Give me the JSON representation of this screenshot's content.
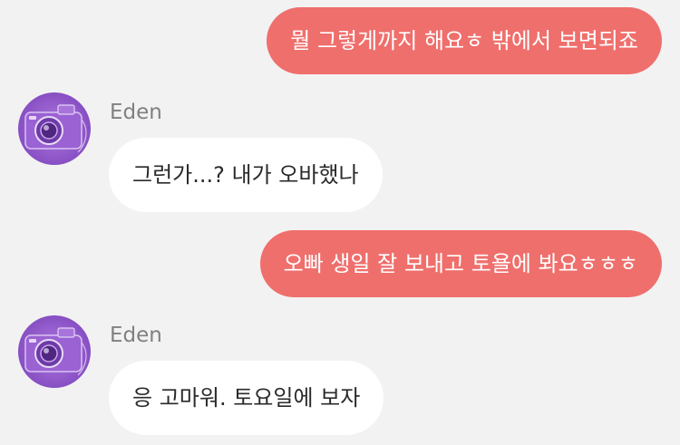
{
  "messages": [
    {
      "direction": "out",
      "text": "뭘 그렇게까지 해요ㅎ 밖에서 보면되죠"
    },
    {
      "direction": "in",
      "sender": "Eden",
      "avatar_icon": "camera-icon",
      "text": "그런가...? 내가 오바했나"
    },
    {
      "direction": "out",
      "text": "오빠 생일 잘 보내고 토욜에 봐요ㅎㅎㅎ"
    },
    {
      "direction": "in",
      "sender": "Eden",
      "avatar_icon": "camera-icon",
      "text": "응 고마워. 토요일에 보자"
    }
  ],
  "colors": {
    "background": "#f2f2f2",
    "outgoing_bubble": "#ef6f6c",
    "incoming_bubble": "#ffffff",
    "sender_name": "#808080",
    "avatar_purple": "#8e56c8"
  }
}
